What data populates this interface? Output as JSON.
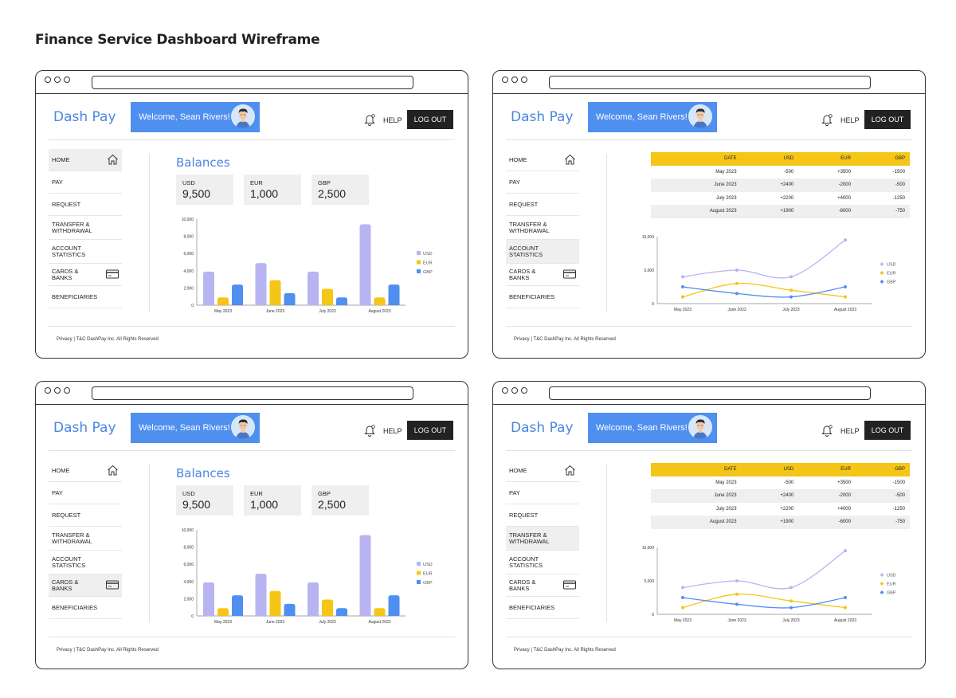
{
  "page_title": "Finance Service Dashboard Wireframe",
  "app": {
    "brand": "Dash Pay",
    "welcome": "Welcome, Sean Rivers!",
    "help": "HELP",
    "logout": "LOG OUT",
    "footer": "Privacy | T&C DashPay Inc. All Rights Reserved"
  },
  "nav": [
    {
      "label": "HOME",
      "icon": "home-icon"
    },
    {
      "label": "PAY",
      "icon": ""
    },
    {
      "label": "REQUEST",
      "icon": ""
    },
    {
      "label": "TRANSFER & WITHDRAWAL",
      "icon": ""
    },
    {
      "label": "ACCOUNT STATISTICS",
      "icon": ""
    },
    {
      "label": "CARDS & BANKS",
      "icon": "card-icon"
    },
    {
      "label": "BENEFICIARIES",
      "icon": ""
    }
  ],
  "balances": {
    "title": "Balances",
    "cards": [
      {
        "currency": "USD",
        "amount": "9,500"
      },
      {
        "currency": "EUR",
        "amount": "1,000"
      },
      {
        "currency": "GBP",
        "amount": "2,500"
      }
    ]
  },
  "table": {
    "headers": [
      "DATE",
      "USD",
      "EUR",
      "GBP"
    ],
    "rows": [
      [
        "May 2023",
        "-500",
        "+3500",
        "-1500"
      ],
      [
        "June 2023",
        "+2400",
        "-2000",
        "-500"
      ],
      [
        "July 2023",
        "+2200",
        "+4000",
        "-1250"
      ],
      [
        "August 2023",
        "+1900",
        "-6000",
        "-750"
      ]
    ]
  },
  "colors": {
    "USD": "#b8b4f2",
    "EUR": "#f5c518",
    "GBP": "#4f8ff0",
    "accent": "#4a86e0"
  },
  "frames": [
    {
      "view": "balances",
      "active_nav": 0
    },
    {
      "view": "statistics",
      "active_nav": 4
    },
    {
      "view": "balances",
      "active_nav": 5
    },
    {
      "view": "statistics",
      "active_nav": 3
    }
  ],
  "chart_data": [
    {
      "type": "bar",
      "categories": [
        "May 2023",
        "June 2023",
        "July 2023",
        "August 2023"
      ],
      "series": [
        {
          "name": "USD",
          "values": [
            3900,
            4900,
            3900,
            9400
          ]
        },
        {
          "name": "EUR",
          "values": [
            900,
            2900,
            1900,
            900
          ]
        },
        {
          "name": "GBP",
          "values": [
            2400,
            1400,
            900,
            2400
          ]
        }
      ],
      "yticks": [
        "0",
        "2,000",
        "4,000",
        "6,000",
        "8,000",
        "10,000"
      ],
      "ylim": [
        0,
        10000
      ],
      "legend": "right"
    },
    {
      "type": "line",
      "categories": [
        "May 2023",
        "June 2023",
        "July 2023",
        "August 2023"
      ],
      "series": [
        {
          "name": "USD",
          "values": [
            4000,
            5000,
            4000,
            9500
          ]
        },
        {
          "name": "EUR",
          "values": [
            1000,
            3000,
            2000,
            1000
          ]
        },
        {
          "name": "GBP",
          "values": [
            2500,
            1500,
            1000,
            2500
          ]
        }
      ],
      "yticks": [
        "0",
        "5,000",
        "10,000"
      ],
      "ylim": [
        0,
        10000
      ],
      "legend": "right"
    }
  ]
}
